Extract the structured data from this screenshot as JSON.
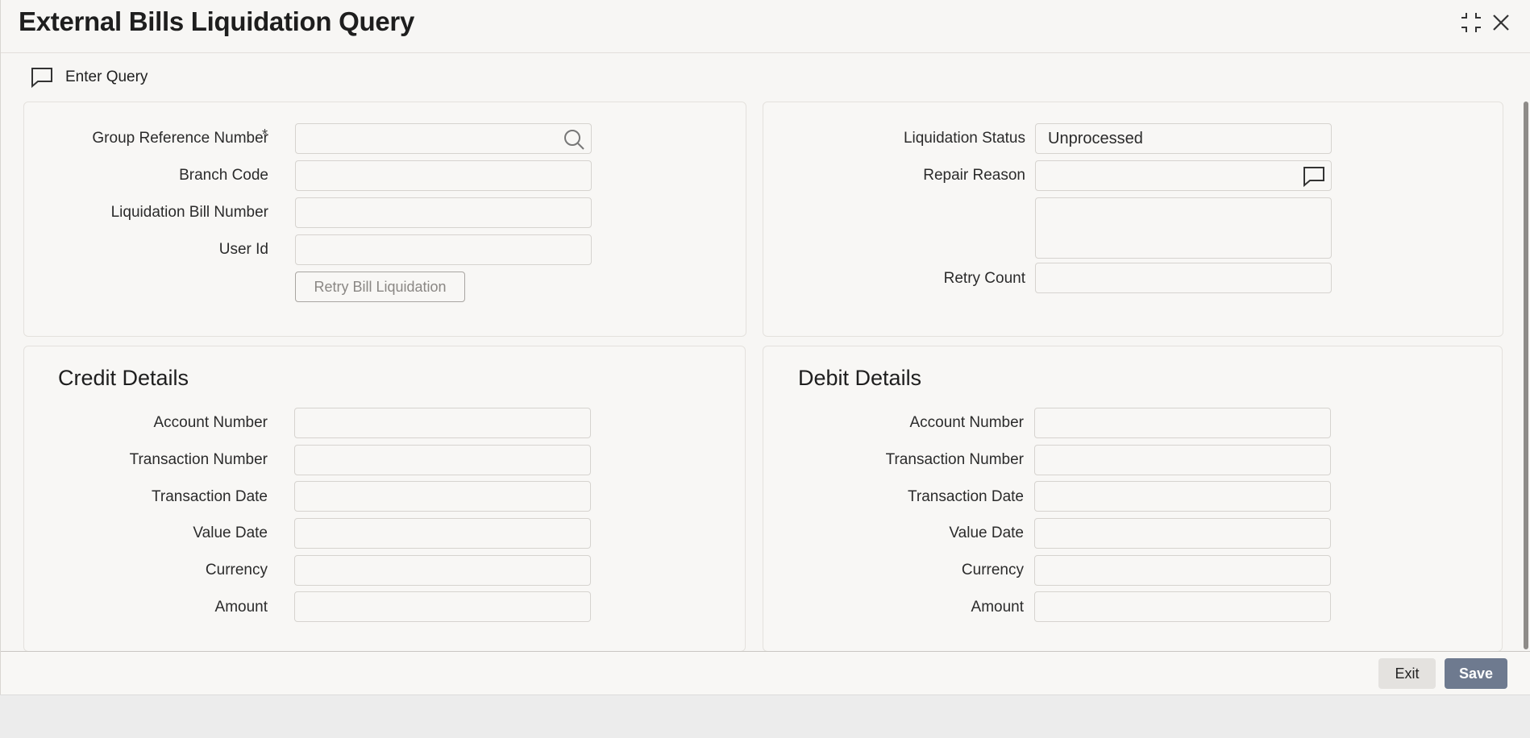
{
  "window": {
    "title": "External Bills Liquidation Query"
  },
  "toolbar": {
    "enter_query_label": "Enter Query"
  },
  "main": {
    "group_reference_label": "Group Reference Number",
    "required_marker": "*",
    "group_reference_value": "",
    "branch_code_label": "Branch Code",
    "branch_code_value": "",
    "liquidation_bill_number_label": "Liquidation Bill Number",
    "liquidation_bill_number_value": "",
    "user_id_label": "User Id",
    "user_id_value": "",
    "retry_button_label": "Retry Bill Liquidation",
    "liquidation_status_label": "Liquidation Status",
    "liquidation_status_value": "Unprocessed",
    "repair_reason_label": "Repair Reason",
    "repair_reason_value": "",
    "repair_reason_text": "",
    "retry_count_label": "Retry Count",
    "retry_count_value": ""
  },
  "credit": {
    "title": "Credit Details",
    "fields": [
      {
        "label": "Account Number",
        "value": ""
      },
      {
        "label": "Transaction Number",
        "value": ""
      },
      {
        "label": "Transaction Date",
        "value": ""
      },
      {
        "label": "Value Date",
        "value": ""
      },
      {
        "label": "Currency",
        "value": ""
      },
      {
        "label": "Amount",
        "value": ""
      }
    ]
  },
  "debit": {
    "title": "Debit Details",
    "fields": [
      {
        "label": "Account Number",
        "value": ""
      },
      {
        "label": "Transaction Number",
        "value": ""
      },
      {
        "label": "Transaction Date",
        "value": ""
      },
      {
        "label": "Value Date",
        "value": ""
      },
      {
        "label": "Currency",
        "value": ""
      },
      {
        "label": "Amount",
        "value": ""
      }
    ]
  },
  "footer": {
    "exit_label": "Exit",
    "save_label": "Save"
  },
  "icons": {
    "maximize": "maximize-icon",
    "close": "close-icon",
    "enter_query": "speech-bubble-icon",
    "search": "search-icon",
    "repair_reason": "speech-bubble-icon"
  },
  "colors": {
    "save_button": "#6e7a8f",
    "background": "#f7f6f4"
  }
}
